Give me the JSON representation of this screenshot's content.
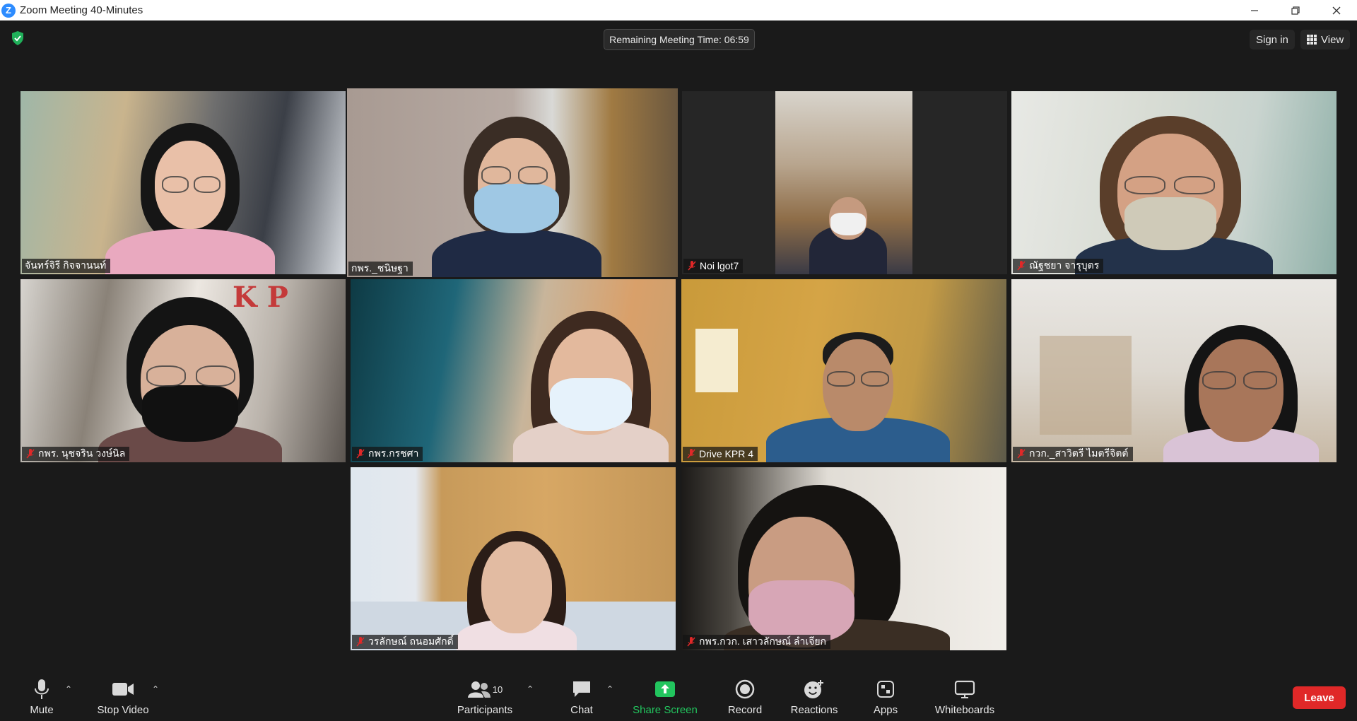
{
  "window": {
    "title": "Zoom Meeting 40-Minutes",
    "logo_letter": "Z"
  },
  "topbar": {
    "remaining_time": "Remaining Meeting Time: 06:59",
    "signin_label": "Sign in",
    "view_label": "View"
  },
  "participants": [
    {
      "name": "จันทร์จิรี กิจจานนท์",
      "muted": false,
      "active": false
    },
    {
      "name": "กพร._ชนิษฐา",
      "muted": false,
      "active": true
    },
    {
      "name": "Noi lgot7",
      "muted": true,
      "active": false
    },
    {
      "name": "ณัฐชยา จารุบุตร",
      "muted": true,
      "active": false
    },
    {
      "name": "กพร. นุชจริน วงษ์นิล",
      "muted": true,
      "active": false
    },
    {
      "name": "กพร.กรชศา",
      "muted": true,
      "active": false
    },
    {
      "name": "Drive KPR 4",
      "muted": true,
      "active": false
    },
    {
      "name": "กวก._สาวิตรี ไมตรีจิตต์",
      "muted": true,
      "active": false
    },
    {
      "name": "วรลักษณ์ ถนอมศักดิ์",
      "muted": true,
      "active": false
    },
    {
      "name": "กพร.กวก. เสาวลักษณ์ ลำเจียก",
      "muted": true,
      "active": false
    }
  ],
  "toolbar": {
    "mute_label": "Mute",
    "stop_video_label": "Stop Video",
    "participants_label": "Participants",
    "participants_count": "10",
    "chat_label": "Chat",
    "share_label": "Share Screen",
    "record_label": "Record",
    "reactions_label": "Reactions",
    "apps_label": "Apps",
    "whiteboards_label": "Whiteboards",
    "leave_label": "Leave"
  },
  "colors": {
    "background": "#1a1a1a",
    "active_speaker_border": "#c8e85a",
    "share_green": "#22c55e",
    "leave_red": "#e02828",
    "mic_off_red": "#e02828"
  }
}
